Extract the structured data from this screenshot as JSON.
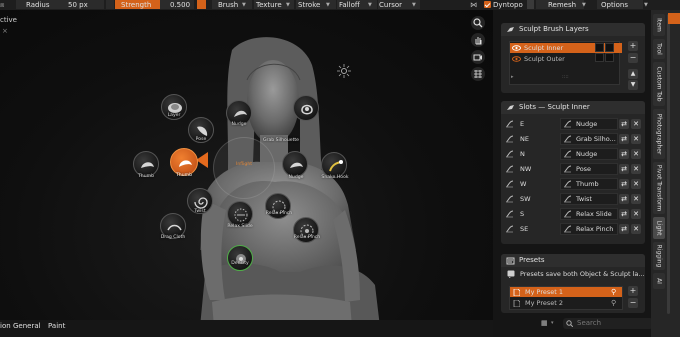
{
  "header": {
    "radius_label": "Radius",
    "radius_value": "50 px",
    "strength_label": "Strength",
    "strength_value": "0.500",
    "menus": [
      "Brush",
      "Texture",
      "Stroke",
      "Falloff",
      "Cursor"
    ],
    "dyntopo_label": "Dyntopo",
    "remesh_label": "Remesh",
    "options_label": "Options"
  },
  "viewport": {
    "mode_text": "ctive",
    "mode_extra": "×"
  },
  "pie_menu": {
    "center_label": "Inflight",
    "items": [
      {
        "label": "Layer",
        "icon": "layer-brush-icon"
      },
      {
        "label": "Nudge",
        "icon": "nudge-brush-icon"
      },
      {
        "label": "Pose",
        "icon": "pose-brush-icon"
      },
      {
        "label": "Grab Silhouette",
        "icon": "grab-silhouette-brush-icon"
      },
      {
        "label": "Thumb",
        "icon": "thumb-brush-icon"
      },
      {
        "label": "Nudge",
        "icon": "nudge-brush-icon"
      },
      {
        "label": "Snake Hook",
        "icon": "snake-hook-brush-icon"
      },
      {
        "label": "Twist",
        "icon": "twist-brush-icon"
      },
      {
        "label": "Relax Pinch",
        "icon": "relax-pinch-brush-icon"
      },
      {
        "label": "Relax Slide",
        "icon": "relax-slide-brush-icon"
      },
      {
        "label": "Drag Cloth",
        "icon": "drag-cloth-brush-icon"
      },
      {
        "label": "Relax Pinch",
        "icon": "relax-pinch-brush-icon"
      },
      {
        "label": "Density",
        "icon": "density-brush-icon"
      }
    ]
  },
  "bottom_tabs": [
    "ion",
    "General",
    "Paint"
  ],
  "sculpt_layers": {
    "title": "Sculpt Brush Layers",
    "layers": [
      {
        "name": "Sculpt Inner",
        "active": true
      },
      {
        "name": "Sculpt Outer",
        "active": false
      }
    ]
  },
  "slots": {
    "title": "Slots — Sculpt Inner",
    "rows": [
      {
        "dir": "E",
        "brush": "Nudge"
      },
      {
        "dir": "NE",
        "brush": "Grab Silho..."
      },
      {
        "dir": "N",
        "brush": "Nudge"
      },
      {
        "dir": "NW",
        "brush": "Pose"
      },
      {
        "dir": "W",
        "brush": "Thumb"
      },
      {
        "dir": "SW",
        "brush": "Twist"
      },
      {
        "dir": "S",
        "brush": "Relax Slide"
      },
      {
        "dir": "SE",
        "brush": "Relax Pinch"
      }
    ]
  },
  "presets": {
    "title": "Presets",
    "info": "Presets save both Object & Sculpt la...",
    "items": [
      {
        "name": "My Preset 1",
        "active": true
      },
      {
        "name": "My Preset 2",
        "active": false
      }
    ]
  },
  "footer": {
    "search_placeholder": "Search"
  },
  "sidebar_tabs": [
    "Item",
    "Tool",
    "Custom Tab",
    "Photographer",
    "Pivot Transform",
    "Light",
    "Rigging",
    "AI"
  ],
  "colors": {
    "accent": "#d4621a",
    "panel": "#262626"
  }
}
